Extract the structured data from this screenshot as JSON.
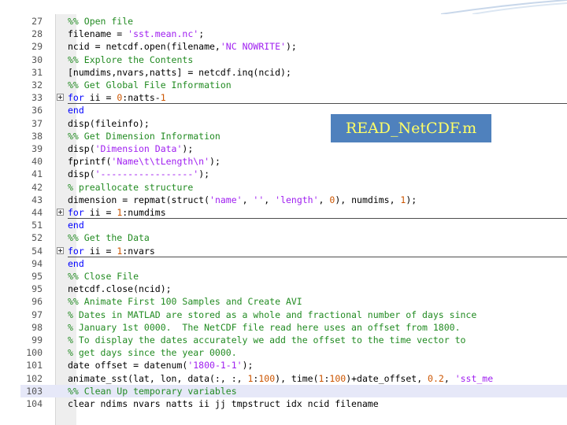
{
  "overlay": {
    "label": "READ_NetCDF.m"
  },
  "colors": {
    "comment": "#228b22",
    "string": "#a020f0",
    "keyword": "#0000ff",
    "number": "#cc5500",
    "label_bg": "#4f81bd",
    "label_text": "#ffff66"
  },
  "editor": {
    "lines": [
      {
        "num": "27",
        "code": "%% Open file"
      },
      {
        "num": "28",
        "code": "filename = 'sst.mean.nc';"
      },
      {
        "num": "29",
        "code": "ncid = netcdf.open(filename,'NC NOWRITE');"
      },
      {
        "num": "30",
        "code": "%% Explore the Contents"
      },
      {
        "num": "31",
        "code": "[numdims,nvars,natts] = netcdf.inq(ncid);"
      },
      {
        "num": "32",
        "code": "%% Get Global File Information"
      },
      {
        "num": "33",
        "code": "for ii = 0:natts-1",
        "folded": true
      },
      {
        "num": "36",
        "code": "end"
      },
      {
        "num": "37",
        "code": "disp(fileinfo);"
      },
      {
        "num": "38",
        "code": "%% Get Dimension Information"
      },
      {
        "num": "39",
        "code": "disp('Dimension Data');"
      },
      {
        "num": "40",
        "code": "fprintf('Name\\t\\tLength\\n');"
      },
      {
        "num": "41",
        "code": "disp('-----------------');"
      },
      {
        "num": "42",
        "code": "% preallocate structure"
      },
      {
        "num": "43",
        "code": "dimension = repmat(struct('name', '', 'length', 0), numdims, 1);"
      },
      {
        "num": "44",
        "code": "for ii = 1:numdims",
        "folded": true
      },
      {
        "num": "51",
        "code": "end"
      },
      {
        "num": "52",
        "code": "%% Get the Data"
      },
      {
        "num": "54",
        "code": "for ii = 1:nvars",
        "folded": true
      },
      {
        "num": "94",
        "code": "end"
      },
      {
        "num": "95",
        "code": "%% Close File"
      },
      {
        "num": "95",
        "code": "netcdf.close(ncid);"
      },
      {
        "num": "96",
        "code": "%% Animate First 100 Samples and Create AVI"
      },
      {
        "num": "97",
        "code": "% Dates in MATLAD are stored as a whole and fractional number of days since"
      },
      {
        "num": "98",
        "code": "% January 1st 0000.  The NetCDF file read here uses an offset from 1800."
      },
      {
        "num": "99",
        "code": "% To display the dates accurately we add the offset to the time vector to"
      },
      {
        "num": "100",
        "code": "% get days since the year 0000."
      },
      {
        "num": "101",
        "code": "date offset = datenum('1800-1-1');"
      },
      {
        "num": "102",
        "code": "animate_sst(lat, lon, data(:, :, 1:100), time(1:100)+date_offset, 0.2, 'sst_me"
      },
      {
        "num": "103",
        "code": "%% Clean Up temporary variables",
        "highlight": true
      },
      {
        "num": "104",
        "code": "clear ndims nvars natts ii jj tmpstruct idx ncid filename"
      }
    ]
  }
}
